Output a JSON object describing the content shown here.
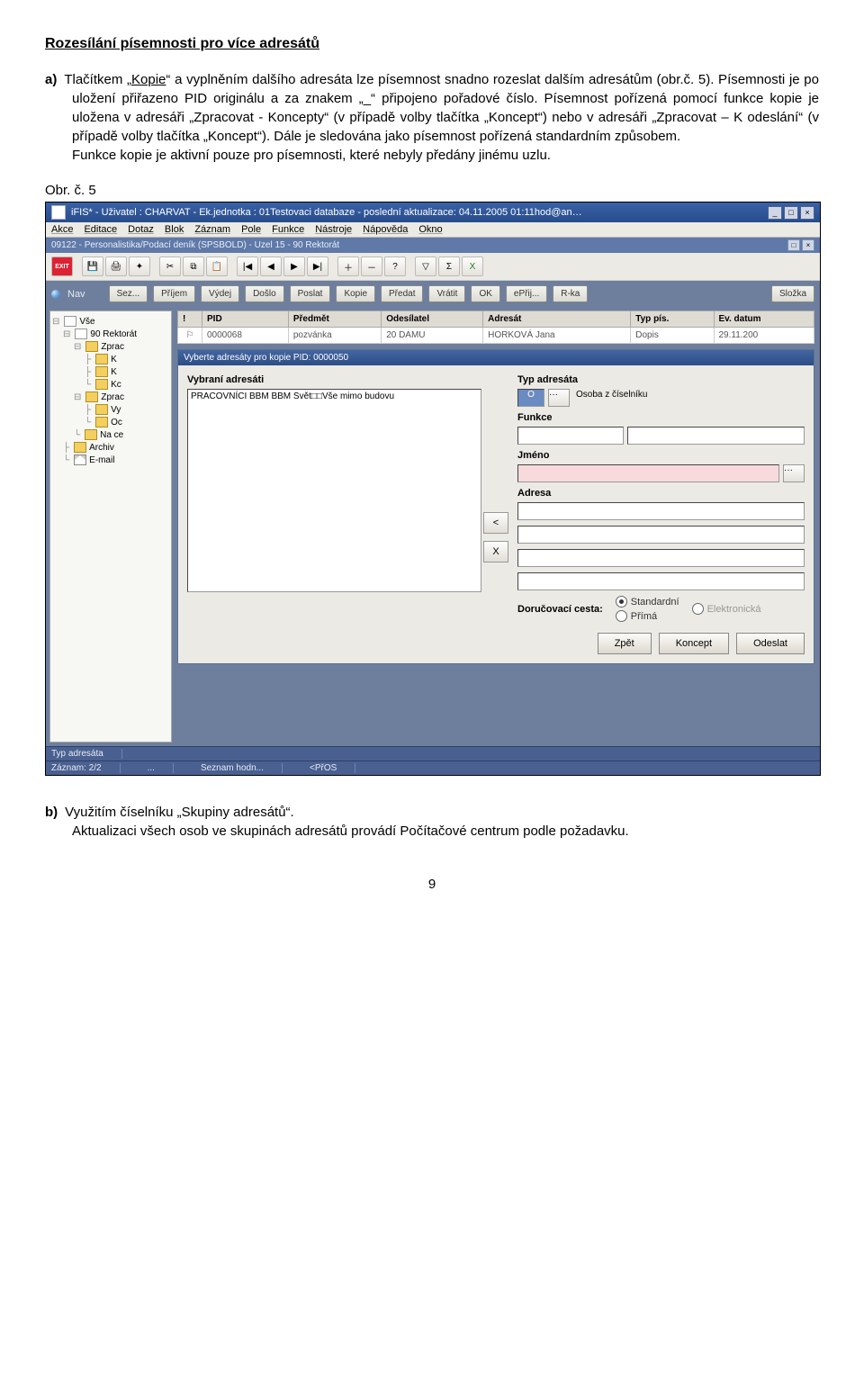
{
  "title": "Rozesílání písemnosti pro více adresátů",
  "para_a": {
    "label": "a)",
    "text_before_kopie": "Tlačítkem „",
    "kopie": "Kopie",
    "text_after": "“ a vyplněním dalšího adresáta lze písemnost snadno rozeslat dalším adresátům (obr.č. 5). Písemnosti je po uložení přiřazeno PID originálu a za znakem „_“ připojeno pořadové číslo. Písemnost pořízená pomocí funkce kopie je uložena v adresáři „Zpracovat - Koncepty“ (v případě volby tlačítka „Koncept“) nebo v adresáři „Zpracovat – K odeslání“ (v případě volby tlačítka „Koncept“). Dále je sledována jako písemnost pořízená standardním způsobem.",
    "line2": "Funkce kopie je aktivní pouze pro písemnosti, které nebyly předány jinému uzlu."
  },
  "fig_label": "Obr. č. 5",
  "app_title": "iFIS* - Uživatel : CHARVAT - Ek.jednotka : 01Testovaci databaze - poslední aktualizace: 04.11.2005 01:11hod@an…",
  "menu": [
    "Akce",
    "Editace",
    "Dotaz",
    "Blok",
    "Záznam",
    "Pole",
    "Funkce",
    "Nástroje",
    "Nápověda",
    "Okno"
  ],
  "subtitle": "09122 - Personalistika/Podací deník (SPSBOLD) - Uzel 15 - 90 Rektorát",
  "sub_restore": "□",
  "sub_close": "×",
  "nav_label": "Nav",
  "nav_buttons": [
    "Sez...",
    "Příjem",
    "Výdej",
    "Došlo",
    "Poslat",
    "Kopie",
    "Předat",
    "Vrátit",
    "OK",
    "ePřij...",
    "R-ka"
  ],
  "nav_right": "Složka",
  "tree": {
    "root": "Vše",
    "n1": "90 Rektorát",
    "n2a": "Zprac",
    "n2b": "K",
    "n2c": "K",
    "n2d": "Kc",
    "n3a": "Zprac",
    "n3b": "Vy",
    "n3c": "Oc",
    "n4": "Na ce",
    "archiv": "Archiv",
    "email": "E-mail"
  },
  "table": {
    "h_excl": "!",
    "h_pid": "PID",
    "h_subject": "Předmět",
    "h_sender": "Odesílatel",
    "h_recipient": "Adresát",
    "h_type": "Typ pís.",
    "h_date": "Ev. datum",
    "r1": {
      "pid": "0000068",
      "subject": "pozvánka",
      "sender": "20 DAMU",
      "recipient": "HORKOVÁ Jana",
      "type": "Dopis",
      "date": "29.11.200"
    }
  },
  "dialog": {
    "title": "Vyberte adresáty pro kopie PID: 0000050",
    "left_label": "Vybraní adresáti",
    "list_item": "PRACOVNÍCI BBM BBM  Svět□□Vše mimo budovu",
    "right_type_label": "Typ adresáta",
    "type_code": "O",
    "type_text": "Osoba z číselníku",
    "func_label": "Funkce",
    "name_label": "Jméno",
    "addr_label": "Adresa",
    "delivery_label": "Doručovací cesta:",
    "radio_std": "Standardní",
    "radio_direct": "Přímá",
    "radio_elec": "Elektronická",
    "btn_back": "Zpět",
    "btn_concept": "Koncept",
    "btn_send": "Odeslat",
    "btn_lt": "<",
    "btn_x": "X"
  },
  "status": {
    "s1": "Typ adresáta",
    "s2": "Záznam: 2/2",
    "s3": "...",
    "s4": "Seznam hodn...",
    "s5": "<PřOS"
  },
  "para_b": {
    "label": "b)",
    "text": "Využitím číselníku „Skupiny adresátů“.",
    "line2": "Aktualizaci všech osob ve skupinách adresátů provádí Počítačové centrum podle požadavku."
  },
  "page_number": "9"
}
